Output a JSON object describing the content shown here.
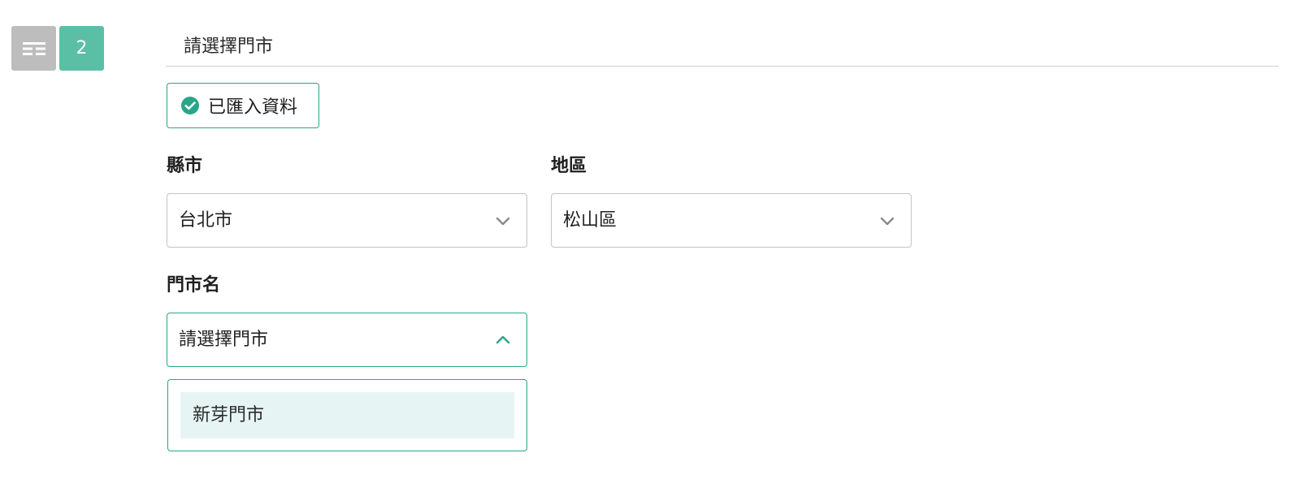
{
  "step": {
    "number": "2",
    "icon": "list-icon",
    "title": "請選擇門市"
  },
  "badge": {
    "icon": "check-circle-icon",
    "label": "已匯入資料"
  },
  "fields": {
    "city": {
      "label": "縣市",
      "value": "台北市",
      "icon": "chevron-down-icon"
    },
    "district": {
      "label": "地區",
      "value": "松山區",
      "icon": "chevron-down-icon"
    },
    "store": {
      "label": "門市名",
      "placeholder": "請選擇門市",
      "icon": "chevron-up-icon",
      "options": [
        "新芽門市"
      ]
    }
  },
  "colors": {
    "accent": "#2aa58a",
    "step_badge": "#5bbfa5",
    "step_icon_bg": "#bdbdbd",
    "option_highlight": "#e6f5f3"
  }
}
